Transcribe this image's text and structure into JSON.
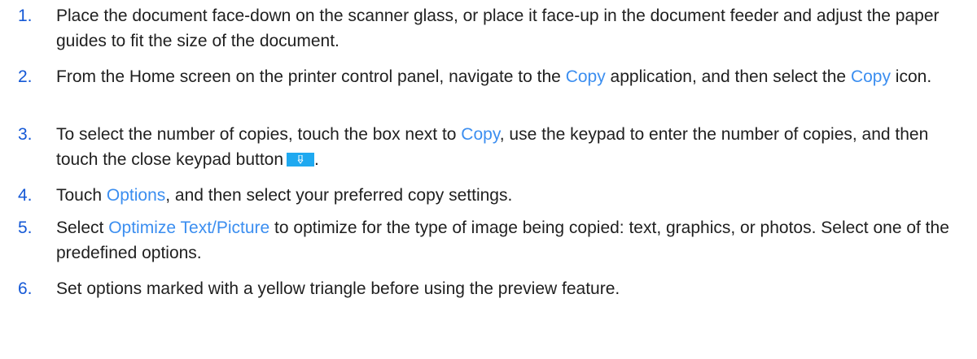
{
  "steps": [
    {
      "number": "1.",
      "text": "Place the document face-down on the scanner glass, or place it face-up in the document feeder and adjust the paper guides to fit the size of the document."
    },
    {
      "number": "2.",
      "pre": "From the Home screen on the printer control panel, navigate to the ",
      "link1": "Copy",
      "mid": " application, and then select the ",
      "link2": "Copy",
      "post": " icon."
    },
    {
      "number": "3.",
      "pre": "To select the number of copies, touch the box next to ",
      "link1": "Copy",
      "post": ", use the keypad to enter the number of copies, and then touch the close keypad button",
      "end": ".",
      "button_icon": "close-keypad-icon",
      "button_color": "#1fa9f0"
    },
    {
      "number": "4.",
      "pre": "Touch ",
      "link1": "Options",
      "post": ", and then select your preferred copy settings."
    },
    {
      "number": "5.",
      "pre": "Select ",
      "link1": "Optimize Text/Picture",
      "post": " to optimize for the type of image being copied: text, graphics, or photos. Select one of the predefined options."
    },
    {
      "number": "6.",
      "text": "Set options marked with a yellow triangle before using the preview feature."
    }
  ],
  "colors": {
    "number": "#1458d6",
    "link": "#3b8ef0",
    "text": "#1f1f1f"
  }
}
